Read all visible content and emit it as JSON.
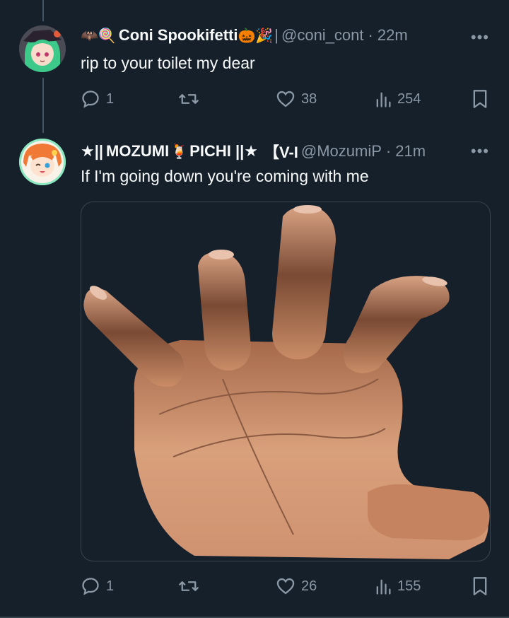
{
  "colors": {
    "background": "#15202b",
    "text": "#f7f9f9",
    "secondary": "#8b98a5",
    "border": "#38444d"
  },
  "tweets": [
    {
      "name_prefix_emoji": "🦇🍭",
      "name": "Coni Spookifetti",
      "name_suffix_emoji": "🎃🎉",
      "name_sep": "|",
      "handle": "@coni_cont",
      "dot": "·",
      "time": "22m",
      "more": "•••",
      "text": "rip to your toilet my dear",
      "stats": {
        "replies": "1",
        "retweets": "",
        "likes": "38",
        "views": "254"
      }
    },
    {
      "name_prefix_emoji": "★||",
      "name": "MOZUMI",
      "name_mid_emoji": "🍹",
      "name_rest": "PICHI ||★",
      "name_bracket": "【V-I",
      "handle": "@MozumiP",
      "dot": "·",
      "time": "21m",
      "more": "•••",
      "text": "If I'm going down you're coming with me",
      "media_icon": "reaching-hand-image",
      "stats": {
        "replies": "1",
        "retweets": "",
        "likes": "26",
        "views": "155"
      }
    }
  ],
  "icons": {
    "reply": "reply-icon",
    "retweet": "retweet-icon",
    "like": "heart-icon",
    "views": "views-icon",
    "bookmark": "bookmark-icon",
    "more": "more-icon"
  }
}
